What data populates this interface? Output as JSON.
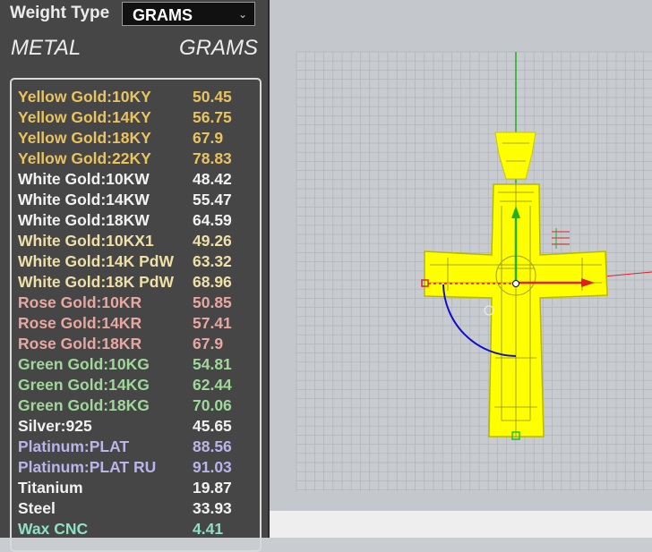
{
  "weight_type": {
    "label": "Weight Type",
    "selected": "GRAMS"
  },
  "headers": {
    "metal": "METAL",
    "grams": "GRAMS"
  },
  "rows": [
    {
      "metal": "Yellow Gold:10KY",
      "grams": "50.45",
      "color": "#e8c35e"
    },
    {
      "metal": "Yellow Gold:14KY",
      "grams": "56.75",
      "color": "#e8c35e"
    },
    {
      "metal": "Yellow Gold:18KY",
      "grams": "67.9",
      "color": "#e8c35e"
    },
    {
      "metal": "Yellow Gold:22KY",
      "grams": "78.83",
      "color": "#e8c35e"
    },
    {
      "metal": "White Gold:10KW",
      "grams": "48.42",
      "color": "#f2f2f2"
    },
    {
      "metal": "White Gold:14KW",
      "grams": "55.47",
      "color": "#f2f2f2"
    },
    {
      "metal": "White Gold:18KW",
      "grams": "64.59",
      "color": "#f2f2f2"
    },
    {
      "metal": "White Gold:10KX1",
      "grams": "49.26",
      "color": "#efe0a8"
    },
    {
      "metal": "White Gold:14K PdW",
      "grams": "63.32",
      "color": "#efe0a8"
    },
    {
      "metal": "White Gold:18K PdW",
      "grams": "68.96",
      "color": "#efe0a8"
    },
    {
      "metal": "Rose Gold:10KR",
      "grams": "50.85",
      "color": "#e9a7a1"
    },
    {
      "metal": "Rose Gold:14KR",
      "grams": "57.41",
      "color": "#e9a7a1"
    },
    {
      "metal": "Rose Gold:18KR",
      "grams": "67.9",
      "color": "#e9a7a1"
    },
    {
      "metal": "Green Gold:10KG",
      "grams": "54.81",
      "color": "#9fd99a"
    },
    {
      "metal": "Green Gold:14KG",
      "grams": "62.44",
      "color": "#9fd99a"
    },
    {
      "metal": "Green Gold:18KG",
      "grams": "70.06",
      "color": "#9fd99a"
    },
    {
      "metal": "Silver:925",
      "grams": "45.65",
      "color": "#f2f2f2"
    },
    {
      "metal": "Platinum:PLAT",
      "grams": "88.56",
      "color": "#b9b4ea"
    },
    {
      "metal": "Platinum:PLAT RU",
      "grams": "91.03",
      "color": "#b9b4ea"
    },
    {
      "metal": "Titanium",
      "grams": "19.87",
      "color": "#f2f2f2"
    },
    {
      "metal": "Steel",
      "grams": "33.93",
      "color": "#f2f2f2"
    },
    {
      "metal": "Wax  CNC",
      "grams": "4.41",
      "color": "#8fe0c4"
    }
  ],
  "colors": {
    "panel_bg": "#464646",
    "viewport_bg": "#c4c7cb",
    "grid_line": "#b0b3b8",
    "model_fill": "#ffff00",
    "x_axis": "#e02020",
    "y_axis": "#20b020",
    "z_ring": "#1010c8"
  }
}
